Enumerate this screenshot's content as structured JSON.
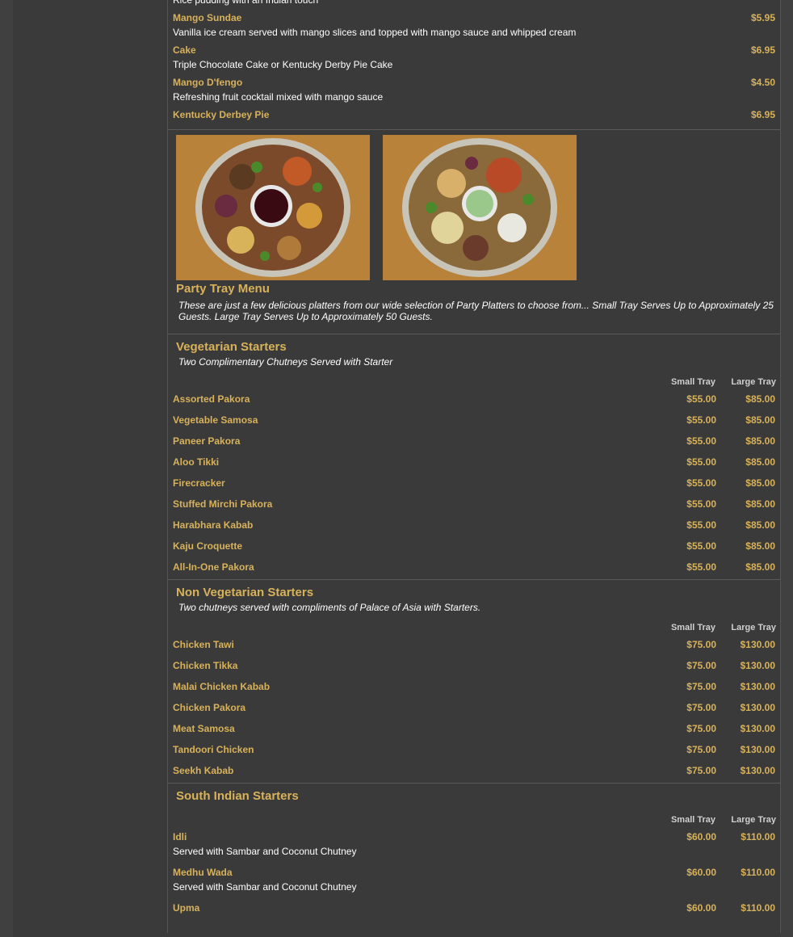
{
  "desserts": [
    {
      "name": "",
      "desc": "Rice pudding with an Indian touch",
      "price": ""
    },
    {
      "name": "Mango Sundae",
      "desc": "Vanilla ice cream served with mango slices and topped with mango sauce and whipped cream",
      "price": "$5.95"
    },
    {
      "name": "Cake",
      "desc": "Triple Chocolate Cake or Kentucky Derby Pie Cake",
      "price": "$6.95"
    },
    {
      "name": "Mango D'fengo",
      "desc": "Refreshing fruit cocktail mixed with mango sauce",
      "price": "$4.50"
    },
    {
      "name": "Kentucky Derbey Pie",
      "desc": "",
      "price": "$6.95"
    }
  ],
  "party": {
    "title": "Party Tray Menu",
    "note": "These are just a few delicious platters from our wide selection of Party Platters to choose from... Small Tray Serves Up to Approximately 25 Guests. Large Tray Serves Up to Approximately 50 Guests."
  },
  "columns": {
    "small": "Small Tray",
    "large": "Large Tray"
  },
  "veg": {
    "title": "Vegetarian Starters",
    "note": "Two Complimentary Chutneys Served with Starter",
    "items": [
      {
        "name": "Assorted Pakora",
        "small": "$55.00",
        "large": "$85.00"
      },
      {
        "name": "Vegetable Samosa",
        "small": "$55.00",
        "large": "$85.00"
      },
      {
        "name": "Paneer Pakora",
        "small": "$55.00",
        "large": "$85.00"
      },
      {
        "name": "Aloo Tikki",
        "small": "$55.00",
        "large": "$85.00"
      },
      {
        "name": "Firecracker",
        "small": "$55.00",
        "large": "$85.00"
      },
      {
        "name": "Stuffed Mirchi Pakora",
        "small": "$55.00",
        "large": "$85.00"
      },
      {
        "name": "Harabhara Kabab",
        "small": "$55.00",
        "large": "$85.00"
      },
      {
        "name": "Kaju Croquette",
        "small": "$55.00",
        "large": "$85.00"
      },
      {
        "name": "All-In-One Pakora",
        "small": "$55.00",
        "large": "$85.00"
      }
    ]
  },
  "nonveg": {
    "title": "Non Vegetarian Starters",
    "note": "Two chutneys served with compliments of Palace of Asia with Starters.",
    "items": [
      {
        "name": "Chicken Tawi",
        "small": "$75.00",
        "large": "$130.00"
      },
      {
        "name": "Chicken Tikka",
        "small": "$75.00",
        "large": "$130.00"
      },
      {
        "name": "Malai Chicken Kabab",
        "small": "$75.00",
        "large": "$130.00"
      },
      {
        "name": "Chicken Pakora",
        "small": "$75.00",
        "large": "$130.00"
      },
      {
        "name": "Meat Samosa",
        "small": "$75.00",
        "large": "$130.00"
      },
      {
        "name": "Tandoori Chicken",
        "small": "$75.00",
        "large": "$130.00"
      },
      {
        "name": "Seekh Kabab",
        "small": "$75.00",
        "large": "$130.00"
      }
    ]
  },
  "south": {
    "title": "South Indian Starters",
    "items": [
      {
        "name": "Idli",
        "desc": "Served with Sambar and Coconut Chutney",
        "small": "$60.00",
        "large": "$110.00"
      },
      {
        "name": "Medhu Wada",
        "desc": "Served with Sambar and Coconut Chutney",
        "small": "$60.00",
        "large": "$110.00"
      },
      {
        "name": "Upma",
        "desc": "",
        "small": "$60.00",
        "large": "$110.00"
      }
    ]
  },
  "colors": {
    "accent": "#d8b25a",
    "background": "#3a3a3a",
    "text": "#ffffff"
  }
}
